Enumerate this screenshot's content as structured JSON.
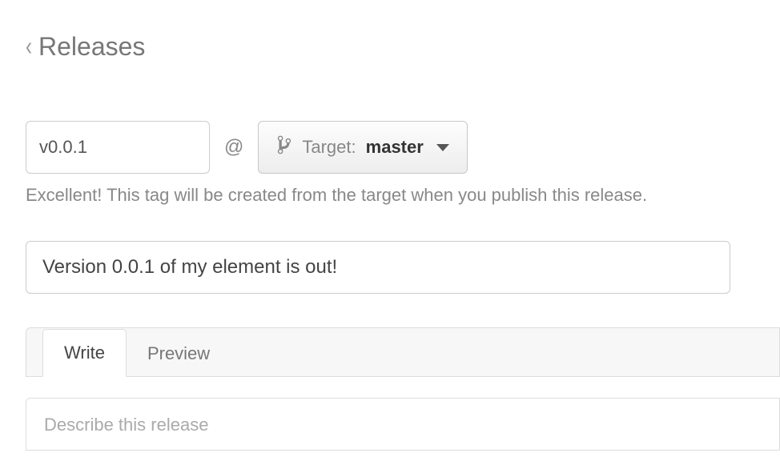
{
  "header": {
    "title": "Releases"
  },
  "tag": {
    "value": "v0.0.1",
    "at": "@"
  },
  "target": {
    "label": "Target:",
    "value": "master"
  },
  "hint": "Excellent! This tag will be created from the target when you publish this release.",
  "release_title": {
    "value": "Version 0.0.1 of my element is out!"
  },
  "tabs": {
    "write": "Write",
    "preview": "Preview"
  },
  "description": {
    "placeholder": "Describe this release"
  }
}
